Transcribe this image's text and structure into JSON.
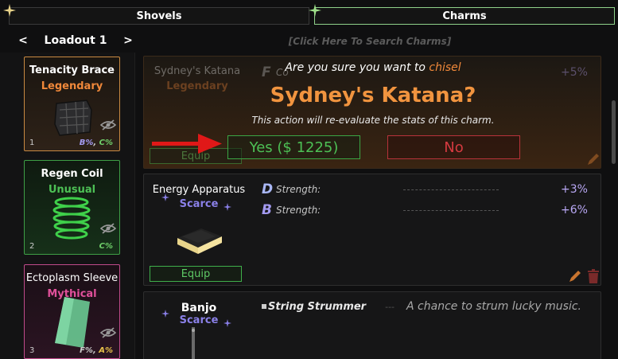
{
  "tabs": {
    "shovels": "Shovels",
    "charms": "Charms"
  },
  "loadout": {
    "prev": "<",
    "title": "Loadout 1",
    "next": ">"
  },
  "search": {
    "placeholder": "[Click Here To Search Charms]"
  },
  "equipped": [
    {
      "name": "Tenacity Brace",
      "rarity": "Legendary",
      "num": "1",
      "tag1": "B%",
      "tag_sep": ", ",
      "tag2": "C%"
    },
    {
      "name": "Regen Coil",
      "rarity": "Unusual",
      "num": "2",
      "tag1": "C%"
    },
    {
      "name": "Ectoplasm Sleeve",
      "rarity": "Mythical",
      "num": "3",
      "tag1": "F%",
      "tag_sep": ", ",
      "tag2": "A%"
    }
  ],
  "rows": {
    "katana": {
      "name": "Sydney's Katana",
      "rarity": "Legendary",
      "grade": "F",
      "stat_partial": "Co",
      "value": "+5%",
      "equip": "Equip"
    },
    "energy": {
      "name": "Energy Apparatus",
      "rarity": "Scarce",
      "equip": "Equip",
      "stats": [
        {
          "grade": "D",
          "label": "Strength:",
          "value": "+3%"
        },
        {
          "grade": "B",
          "label": "Strength:",
          "value": "+6%"
        }
      ]
    },
    "banjo": {
      "name": "Banjo",
      "rarity": "Scarce",
      "ability": "String Strummer",
      "sep": "---",
      "description": "A chance to strum lucky music."
    }
  },
  "dialog": {
    "prompt": "Are you sure you want to",
    "keyword": "chisel",
    "target": "Sydney's Katana?",
    "note": "This action will re-evaluate the stats of this charm.",
    "yes": "Yes ($ 1225)",
    "no": "No"
  },
  "colors": {
    "legendary": "#f0883a",
    "unusual": "#4dc055",
    "mythical": "#e0509a",
    "scarce": "#8a80e8",
    "accent_green": "#4dc055",
    "danger_red": "#d53a40"
  }
}
